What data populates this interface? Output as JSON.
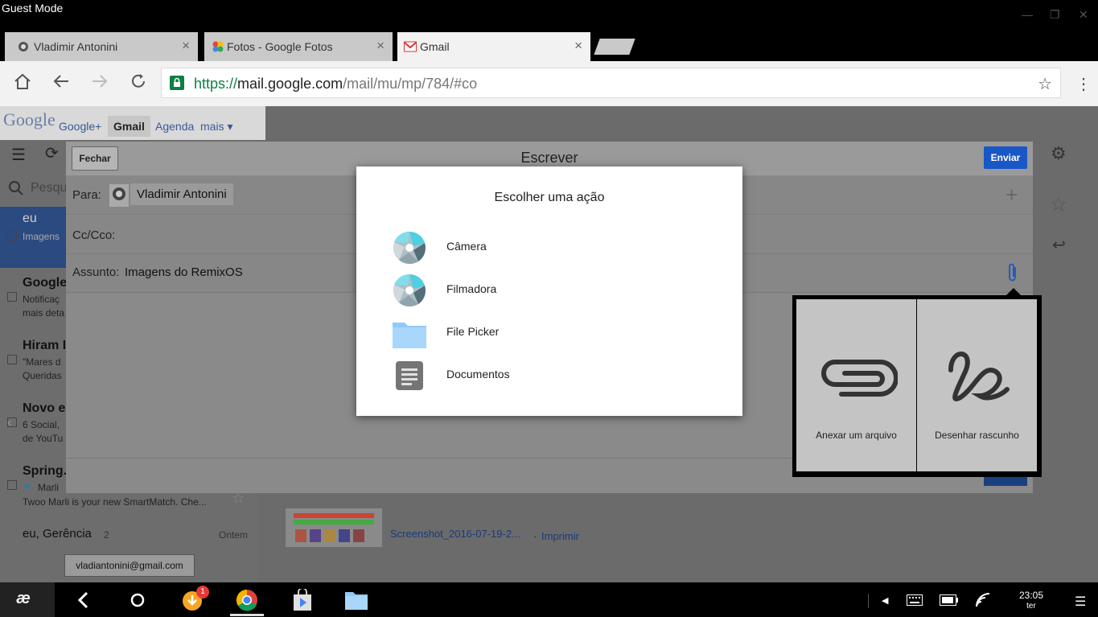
{
  "window": {
    "mode_label": "Guest Mode"
  },
  "tabs": [
    {
      "label": "Vladimir Antonini",
      "active": false
    },
    {
      "label": "Fotos - Google Fotos",
      "active": false
    },
    {
      "label": "Gmail",
      "active": true
    }
  ],
  "toolbar": {
    "url_scheme": "https://",
    "url_host": "mail.google.com",
    "url_path": "/mail/mu/mp/784/#co"
  },
  "gbar": {
    "logo": "Google",
    "items": [
      "Google+",
      "Gmail",
      "Agenda",
      "mais ▾"
    ]
  },
  "mail_list": {
    "search_placeholder": "Pesqu",
    "items": [
      {
        "from": "eu",
        "line2": "Imagens",
        "line3": ""
      },
      {
        "from": "Google",
        "line2": "Notificaç",
        "line3": "mais deta"
      },
      {
        "from": "Hiram I",
        "line2": "\"Mares d",
        "line3": "Queridas"
      },
      {
        "from": "Novo e",
        "line2": "6 Social, ",
        "line3": "de YouTu"
      },
      {
        "from": "Spring.",
        "line2": "Marli",
        "line3": "Twoo Marli is your new SmartMatch. Che..."
      },
      {
        "from": "eu, Gerência",
        "count": "2",
        "date": "Ontem",
        "line2": "",
        "line3": ""
      }
    ],
    "account_chip": "vladiantonini@gmail.com"
  },
  "compose": {
    "close_label": "Fechar",
    "title": "Escrever",
    "send_label": "Enviar",
    "to_label": "Para:",
    "to_value": "Vladimir Antonini",
    "cc_label": "Cc/Cco:",
    "subject_label": "Assunto:",
    "subject_value": "Imagens do RemixOS"
  },
  "dialog": {
    "title": "Escolher uma ação",
    "actions": [
      {
        "label": "Câmera",
        "icon": "camera-aperture-icon"
      },
      {
        "label": "Filmadora",
        "icon": "camera-aperture-icon"
      },
      {
        "label": "File Picker",
        "icon": "folder-icon"
      },
      {
        "label": "Documentos",
        "icon": "document-icon"
      }
    ]
  },
  "attach_popover": {
    "attach_label": "Anexar um arquivo",
    "draw_label": "Desenhar rascunho"
  },
  "attachment": {
    "filename": "Screenshot_2016-07-19-2...",
    "print": "Imprimir"
  },
  "taskbar": {
    "download_badge": "1",
    "time": "23:05",
    "day": "ter"
  },
  "colors": {
    "accent": "#1a57c6",
    "url_green": "#0b8043"
  }
}
